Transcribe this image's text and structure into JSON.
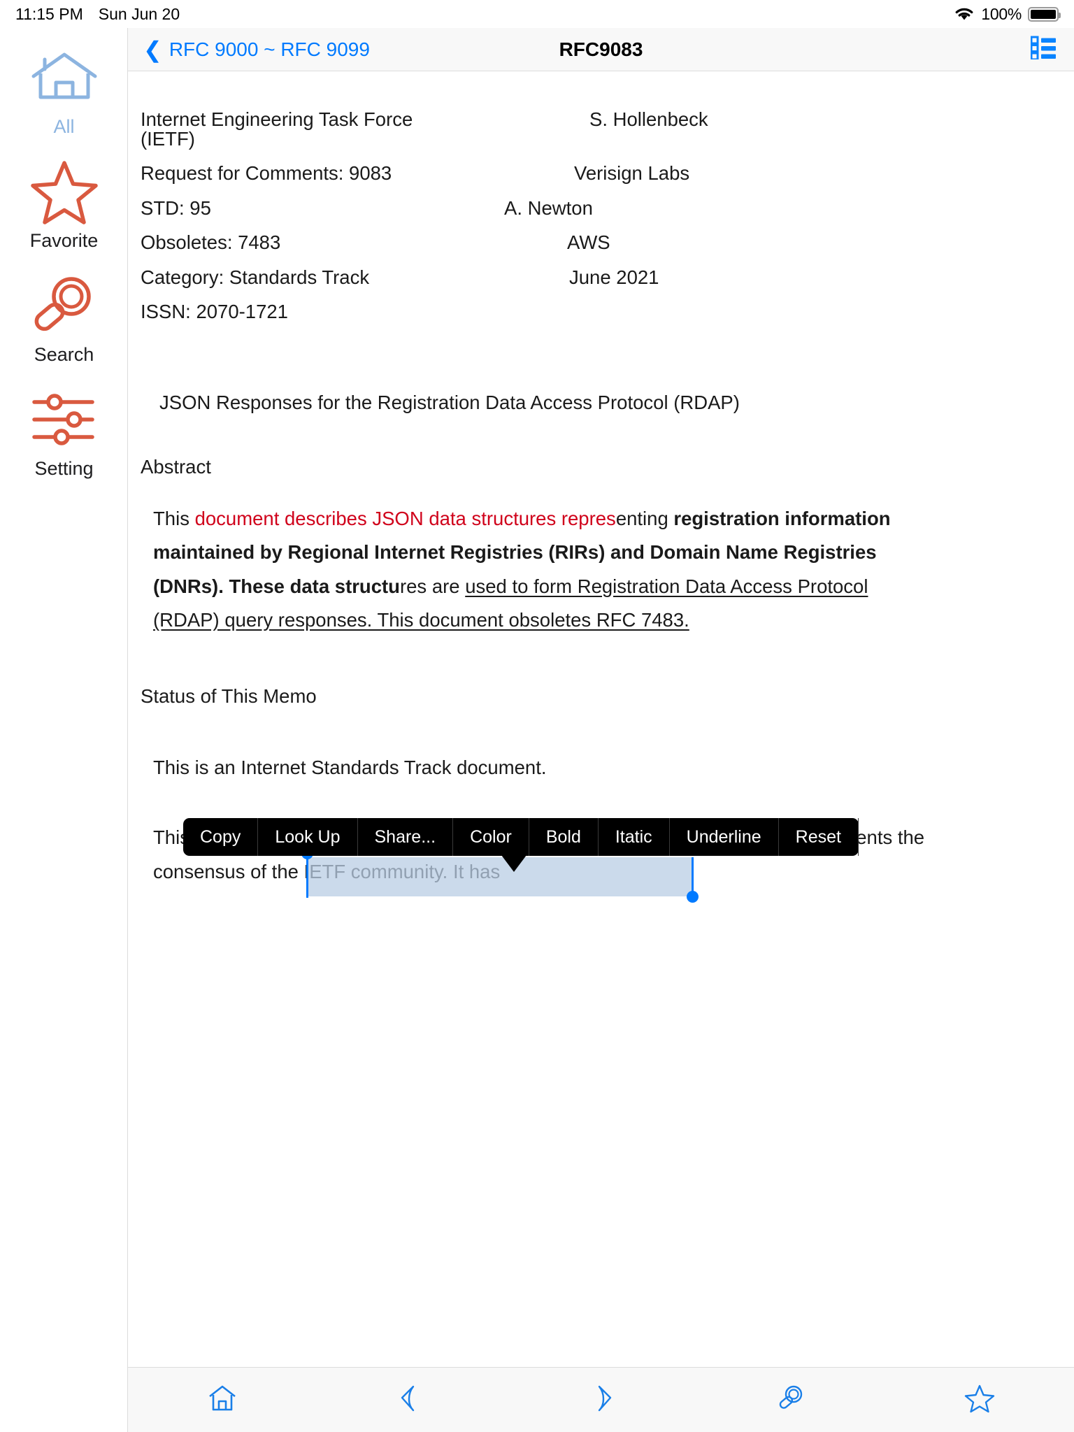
{
  "status_bar": {
    "time": "11:15 PM",
    "date": "Sun Jun 20",
    "battery_percent": "100%",
    "wifi_icon": "wifi-icon",
    "battery_icon": "battery-full-icon"
  },
  "sidebar": {
    "items": [
      {
        "label": "All",
        "icon": "home-icon",
        "active": true
      },
      {
        "label": "Favorite",
        "icon": "star-icon",
        "active": false
      },
      {
        "label": "Search",
        "icon": "magnifier-icon",
        "active": false
      },
      {
        "label": "Setting",
        "icon": "sliders-icon",
        "active": false
      }
    ]
  },
  "navbar": {
    "back_label": "RFC 9000 ~ RFC 9099",
    "back_icon": "chevron-left-icon",
    "title": "RFC9083",
    "toc_icon": "list-icon"
  },
  "context_menu": {
    "items": [
      "Copy",
      "Look Up",
      "Share...",
      "Color",
      "Bold",
      "Itatic",
      "Underline",
      "Reset"
    ]
  },
  "document": {
    "header_rows": [
      {
        "left": "Internet Engineering Task Force (IETF)",
        "right": "S. Hollenbeck",
        "right_indent": 212
      },
      {
        "left": "Request for Comments: 9083",
        "right": "Verisign Labs",
        "right_indent": 190
      },
      {
        "left": "STD: 95",
        "right": "A. Newton",
        "right_indent": 90
      },
      {
        "left": "Obsoletes: 7483",
        "right": "AWS",
        "right_indent": 180
      },
      {
        "left": "Category: Standards Track",
        "right": "June 2021",
        "right_indent": 183
      },
      {
        "left": "ISSN: 2070-1721",
        "right": "",
        "right_indent": 0
      }
    ],
    "title": "JSON Responses for the Registration Data Access Protocol (RDAP)",
    "abstract_heading": "Abstract",
    "abstract": {
      "plain_start": "This ",
      "selected_red": "document describes JSON data structures repres",
      "after_selection": "enting",
      "bold_part": "registration information maintained by Regional Internet Registries (RIRs) and Domain Name Registries (DNRs).  These data structu",
      "normal_tail": "res are ",
      "underlined_part": "used to form Registration Data Access Protocol (RDAP) query responses.  This document obsoletes RFC 7483."
    },
    "status_heading": "Status of This Memo",
    "status_paragraph_1": "This is an Internet Standards Track document.",
    "status_paragraph_2": "This document is a product of the Internet Engineering Task Force (IETF).  It represents the consensus of the IETF community.  It has"
  },
  "bottom_toolbar": {
    "items": [
      {
        "icon": "home-icon"
      },
      {
        "icon": "back-arrow-icon"
      },
      {
        "icon": "forward-arrow-icon"
      },
      {
        "icon": "magnifier-icon"
      },
      {
        "icon": "star-icon"
      }
    ]
  },
  "colors": {
    "accent_blue": "#007aff",
    "orange": "#d9593f",
    "light_blue": "#8cb4e0",
    "selection_red": "#d0021b",
    "selection_highlight": "#b9cde4"
  }
}
